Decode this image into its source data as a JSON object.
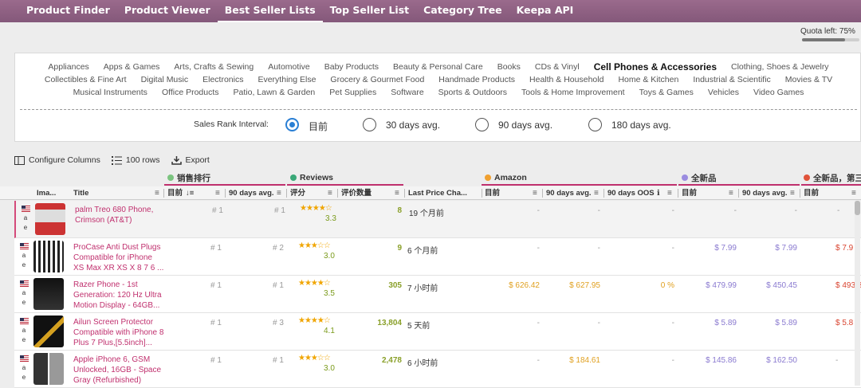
{
  "nav": [
    "Product Finder",
    "Product Viewer",
    "Best Seller Lists",
    "Top Seller List",
    "Category Tree",
    "Keepa API"
  ],
  "nav_active": 2,
  "quota": {
    "label": "Quota left: 75%",
    "fraction": 0.75
  },
  "categories": {
    "row1": [
      "Appliances",
      "Apps & Games",
      "Arts, Crafts & Sewing",
      "Automotive",
      "Baby Products",
      "Beauty & Personal Care",
      "Books",
      "CDs & Vinyl",
      "Cell Phones & Accessories",
      "Clothing, Shoes & Jewelry"
    ],
    "row2": [
      "Collectibles & Fine Art",
      "Digital Music",
      "Electronics",
      "Everything Else",
      "Grocery & Gourmet Food",
      "Handmade Products",
      "Health & Household",
      "Home & Kitchen",
      "Industrial & Scientific",
      "Movies & TV"
    ],
    "row3": [
      "Musical Instruments",
      "Office Products",
      "Patio, Lawn & Garden",
      "Pet Supplies",
      "Software",
      "Sports & Outdoors",
      "Tools & Home Improvement",
      "Toys & Games",
      "Vehicles",
      "Video Games"
    ],
    "selected": "Cell Phones & Accessories"
  },
  "sales_rank": {
    "label": "Sales Rank Interval:",
    "options": [
      "目前",
      "30 days avg.",
      "90 days avg.",
      "180 days avg."
    ],
    "selected": 0
  },
  "toolbar": {
    "configure": "Configure Columns",
    "rows": "100 rows",
    "export": "Export"
  },
  "groups": {
    "sales": "销售排行",
    "reviews": "Reviews",
    "amazon": "Amazon",
    "new": "全新品",
    "new_third": "全新品，第三"
  },
  "colors": {
    "sales": "#7bc47f",
    "reviews": "#3aa878",
    "amazon": "#f0a030",
    "new": "#9b8ce0",
    "new_third": "#e0533a",
    "title": "#c0306e",
    "nav": "#8f6284"
  },
  "headers": {
    "image": "Ima...",
    "title": "Title",
    "current": "目前",
    "sort": "↓≡",
    "avg90": "90 days avg.",
    "rating": "评分",
    "review_count": "评价数量",
    "last_price_change": "Last Price Cha...",
    "amz_current": "目前",
    "amz_avg90": "90 days avg.",
    "amz_oos": "90 days OOS",
    "new_current": "目前",
    "new_avg90": "90 days avg.",
    "new3_current": "目前"
  },
  "rows": [
    {
      "flag_letters": [
        "a",
        "e"
      ],
      "title": "palm Treo 680 Phone, Crimson (AT&T)",
      "rank": "# 1",
      "rank90": "# 1",
      "stars": "★★★★☆",
      "rating": "3.3",
      "reviews": "8",
      "last_change": "19 个月前",
      "amz": "-",
      "amz90": "-",
      "oos": "-",
      "new": "-",
      "new90": "-",
      "new3": "-"
    },
    {
      "flag_letters": [
        "a",
        "e"
      ],
      "title": "ProCase Anti Dust Plugs Compatible for iPhone XS Max XR XS X 8 7 6 ...",
      "rank": "# 1",
      "rank90": "# 2",
      "stars": "★★★☆☆",
      "rating": "3.0",
      "reviews": "9",
      "last_change": "6 个月前",
      "amz": "-",
      "amz90": "-",
      "oos": "-",
      "new": "$ 7.99",
      "new90": "$ 7.99",
      "new3": "$ 7.9"
    },
    {
      "flag_letters": [
        "a",
        "e"
      ],
      "title": "Razer Phone - 1st Generation: 120 Hz Ultra Motion Display - 64GB...",
      "rank": "# 1",
      "rank90": "# 1",
      "stars": "★★★★☆",
      "rating": "3.5",
      "reviews": "305",
      "last_change": "7 小时前",
      "amz": "$ 626.42",
      "amz90": "$ 627.95",
      "oos": "0 %",
      "new": "$ 479.99",
      "new90": "$ 450.45",
      "new3": "$ 493.8"
    },
    {
      "flag_letters": [
        "a",
        "e"
      ],
      "title": "Ailun Screen Protector Compatible with iPhone 8 Plus 7 Plus,[5.5inch]...",
      "rank": "# 1",
      "rank90": "# 3",
      "stars": "★★★★☆",
      "rating": "4.1",
      "reviews": "13,804",
      "last_change": "5 天前",
      "amz": "-",
      "amz90": "-",
      "oos": "-",
      "new": "$ 5.89",
      "new90": "$ 5.89",
      "new3": "$ 5.8"
    },
    {
      "flag_letters": [
        "a",
        "e"
      ],
      "title": "Apple iPhone 6, GSM Unlocked, 16GB - Space Gray (Refurbished)",
      "rank": "# 1",
      "rank90": "# 1",
      "stars": "★★★☆☆",
      "rating": "3.0",
      "reviews": "2,478",
      "last_change": "6 小时前",
      "amz": "-",
      "amz90": "$ 184.61",
      "oos": "-",
      "new": "$ 145.86",
      "new90": "$ 162.50",
      "new3": "-"
    }
  ]
}
